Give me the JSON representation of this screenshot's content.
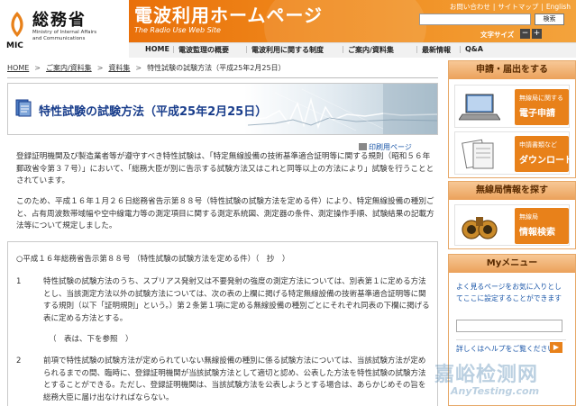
{
  "header": {
    "org_name": "総務省",
    "org_en_1": "Ministry of Internal Affairs",
    "org_en_2": "and Communications",
    "org_abbr": "MIC",
    "site_title": "電波利用ホームページ",
    "site_subtitle": "The Radio Use Web Site",
    "util_links": [
      "お問い合わせ",
      "サイトマップ",
      "English"
    ],
    "search_button": "検索",
    "font_size_label": "文字サイズ",
    "font_minus": "−",
    "font_plus": "+",
    "nav": [
      "HOME",
      "電波監理の概要",
      "電波利用に関する制度",
      "ご案内/資料集",
      "最新情報",
      "Q&A"
    ]
  },
  "breadcrumb": [
    "HOME",
    "ご案内/資料集",
    "資料集",
    "特性試験の試験方法（平成25年2月25日）"
  ],
  "page": {
    "title": "特性試験の試験方法（平成25年2月25日）",
    "print_link": "印刷用ページ",
    "para1": "登録証明機関及び製造業者等が遵守すべき特性試験は、「特定無線設備の技術基準適合証明等に関する規則（昭和５６年郵政省令第３７号）」において、「総務大臣が別に告示する試験方法又はこれと同等以上の方法により」試験を行うこととされています。",
    "para2": "このため、平成１６年１月２６日総務省告示第８８号（特性試験の試験方法を定める件）により、特定無線設備の種別ごと、占有周波数帯域幅や空中線電力等の測定項目に関する測定系統図、測定器の条件、測定操作手順、試験結果の記載方法等について規定しました。"
  },
  "notice": {
    "heading": "○平成１６年総務省告示第８８号 （特性試験の試験方法を定める件）（　抄　）",
    "item1_num": "1",
    "item1_text": "特性試験の試験方法のうち、スプリアス発射又は不要発射の強度の測定方法については、別表第１に定める方法とし、当該測定方法以外の試験方法については、次の表の上欄に掲げる特定無線設備の技術基準適合証明等に関する規則（以下「証明規則」という。）第２条第１項に定める無線設備の種別ごとにそれぞれ同表の下欄に掲げる表に定める方法とする。",
    "note": "（　表は、下を参照　）",
    "item2_num": "2",
    "item2_text": "前項で特性試験の試験方法が定められていない無線設備の種別に係る試験方法については、当該試験方法が定められるまでの間、臨時に、登録証明機関が当該試験方法として適切と認め、公表した方法を特性試験の試験方法とすることができる。ただし、登録証明機関は、当該試験方法を公表しようとする場合は、あらかじめその旨を総務大臣に届け出なければならない。"
  },
  "sidebar": {
    "apply_title": "申請・届出をする",
    "card1_small": "無線局に関する",
    "card1_large": "電子申請",
    "card2_small": "申請書類など",
    "card2_large": "ダウンロード",
    "search_title": "無線局情報を探す",
    "card3_small": "無線局",
    "card3_large": "情報検索",
    "my_title": "Myメニュー",
    "my_text": "よく見るページをお気に入りとしてここに設定することができます",
    "help_link": "詳しくはヘルプをご覧ください"
  },
  "watermark": {
    "jp": "嘉峪检测网",
    "en": "AnyTesting.com"
  }
}
